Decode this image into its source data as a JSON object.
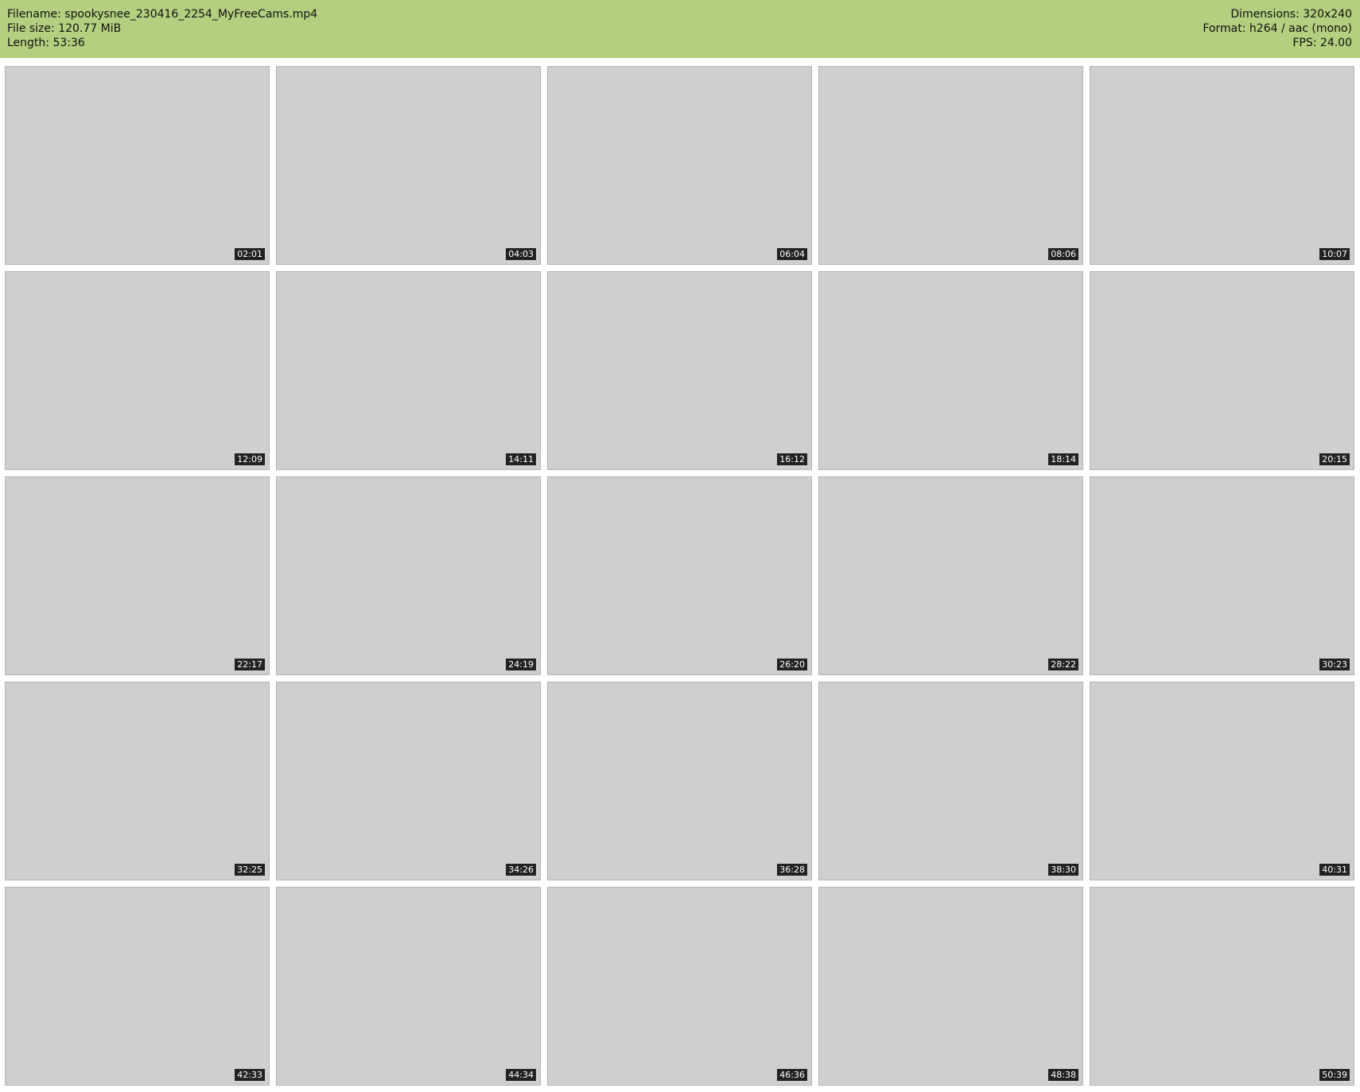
{
  "header": {
    "filename": "Filename: spookysnee_230416_2254_MyFreeCams.mp4",
    "filesize": "File size: 120.77 MiB",
    "length": "Length: 53:36",
    "dimensions": "Dimensions: 320x240",
    "format": "Format: h264 / aac (mono)",
    "fps": "FPS: 24.00"
  },
  "frames": [
    "02:01",
    "04:03",
    "06:04",
    "08:06",
    "10:07",
    "12:09",
    "14:11",
    "16:12",
    "18:14",
    "20:15",
    "22:17",
    "24:19",
    "26:20",
    "28:22",
    "30:23",
    "32:25",
    "34:26",
    "36:28",
    "38:30",
    "40:31",
    "42:33",
    "44:34",
    "46:36",
    "48:38",
    "50:39"
  ]
}
